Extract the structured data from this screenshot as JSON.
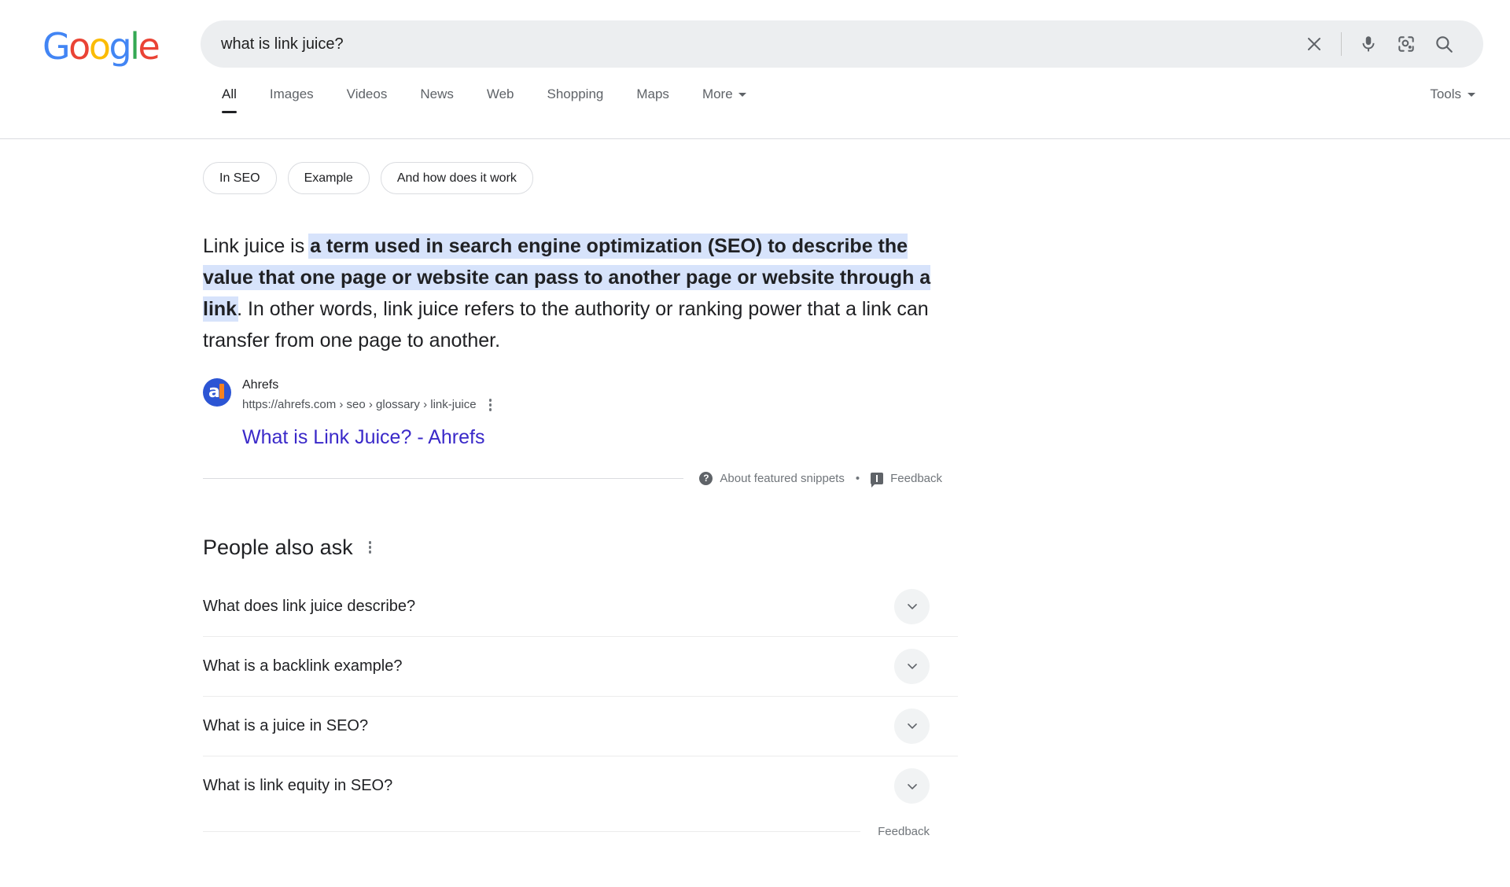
{
  "brand": {
    "logo_letters": [
      {
        "char": "G",
        "color": "#4285F4"
      },
      {
        "char": "o",
        "color": "#EA4335"
      },
      {
        "char": "o",
        "color": "#FBBC05"
      },
      {
        "char": "g",
        "color": "#4285F4"
      },
      {
        "char": "l",
        "color": "#34A853"
      },
      {
        "char": "e",
        "color": "#EA4335"
      }
    ]
  },
  "search": {
    "query": "what is link juice?",
    "placeholder": "Search",
    "clear_icon": "close-icon",
    "voice_icon": "microphone-icon",
    "lens_icon": "google-lens-icon",
    "submit_icon": "search-icon"
  },
  "nav": {
    "tabs": [
      {
        "label": "All",
        "active": true
      },
      {
        "label": "Images",
        "active": false
      },
      {
        "label": "Videos",
        "active": false
      },
      {
        "label": "News",
        "active": false
      },
      {
        "label": "Web",
        "active": false
      },
      {
        "label": "Shopping",
        "active": false
      },
      {
        "label": "Maps",
        "active": false
      },
      {
        "label": "More",
        "active": false,
        "has_caret": true
      }
    ],
    "tools_label": "Tools"
  },
  "related_chips": [
    {
      "label": "In SEO"
    },
    {
      "label": "Example"
    },
    {
      "label": "And how does it work"
    }
  ],
  "featured_snippet": {
    "lead_text": "Link juice is ",
    "highlighted_text": "a term used in search engine optimization (SEO) to describe the value that one page or website can pass to another page or website through a link",
    "trailing_text": ". In other words, link juice refers to the authority or ranking power that a link can transfer from one page to another.",
    "highlight_color": "#d7e3fb",
    "source": {
      "site_name": "Ahrefs",
      "breadcrumb": "https://ahrefs.com › seo › glossary › link-juice",
      "title": "What is Link Juice? - Ahrefs",
      "title_color": "#3a29c9",
      "favicon_letter": "a",
      "favicon_bg": "#2c55d4",
      "favicon_accent": "#f5821f",
      "menu_icon": "kebab-menu-icon"
    },
    "footer": {
      "about_label": "About featured snippets",
      "about_icon": "help-circle-icon",
      "separator": "•",
      "feedback_label": "Feedback",
      "feedback_icon": "flag-feedback-icon"
    }
  },
  "people_also_ask": {
    "title": "People also ask",
    "menu_icon": "kebab-menu-icon",
    "questions": [
      {
        "text": "What does link juice describe?",
        "expand_icon": "chevron-down-icon"
      },
      {
        "text": "What is a backlink example?",
        "expand_icon": "chevron-down-icon"
      },
      {
        "text": "What is a juice in SEO?",
        "expand_icon": "chevron-down-icon"
      },
      {
        "text": "What is link equity in SEO?",
        "expand_icon": "chevron-down-icon"
      }
    ],
    "feedback_label": "Feedback"
  }
}
